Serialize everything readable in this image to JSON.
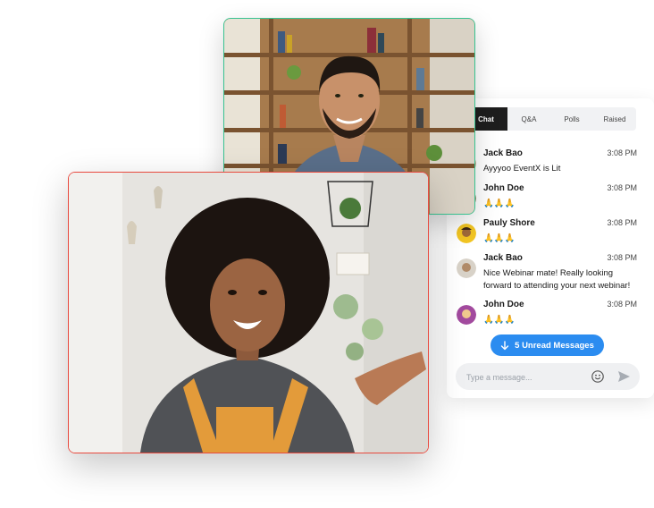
{
  "chat": {
    "tabs": [
      {
        "label": "Chat",
        "active": true
      },
      {
        "label": "Q&A",
        "active": false
      },
      {
        "label": "Polls",
        "active": false
      },
      {
        "label": "Raised",
        "active": false
      }
    ],
    "messages": [
      {
        "name": "Jack Bao",
        "time": "3:08 PM",
        "text": "Ayyyoo EventX is Lit"
      },
      {
        "name": "John Doe",
        "time": "3:08 PM",
        "text": "🙏🙏🙏"
      },
      {
        "name": "Pauly Shore",
        "time": "3:08 PM",
        "text": "🙏🙏🙏"
      },
      {
        "name": "Jack Bao",
        "time": "3:08 PM",
        "text": "Nice Webinar mate! Really looking forward to attending your next webinar!"
      },
      {
        "name": "John Doe",
        "time": "3:08 PM",
        "text": "🙏🙏🙏"
      }
    ],
    "unread_label": "5 Unread Messages",
    "input_placeholder": "Type a message...",
    "icons": {
      "unread": "arrow-down-icon",
      "emoji": "smiley-icon",
      "send": "send-icon"
    }
  },
  "colors": {
    "accent_blue": "#2b8cf0",
    "video_border_green": "#38c290",
    "video_border_red": "#e84a3f"
  }
}
